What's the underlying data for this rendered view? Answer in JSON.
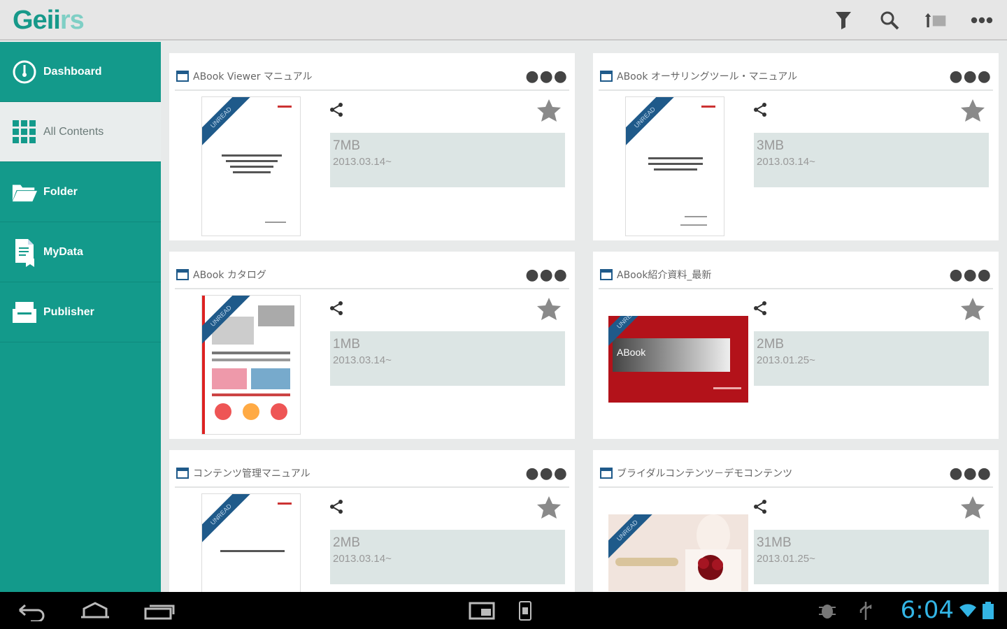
{
  "app": {
    "logo_main": "Geii",
    "logo_dim": "rs"
  },
  "toolbar": {
    "icons": [
      "filter-icon",
      "search-icon",
      "sort-icon",
      "overflow-menu-icon"
    ]
  },
  "sidebar": {
    "items": [
      {
        "label": "Dashboard",
        "icon": "dashboard-icon",
        "active": false
      },
      {
        "label": "All Contents",
        "icon": "grid-icon",
        "active": true
      },
      {
        "label": "Folder",
        "icon": "folder-icon",
        "active": false
      },
      {
        "label": "MyData",
        "icon": "mydata-icon",
        "active": false
      },
      {
        "label": "Publisher",
        "icon": "publisher-icon",
        "active": false
      }
    ]
  },
  "cards": [
    {
      "title": "ABook Viewer マニュアル",
      "size": "7MB",
      "date": "2013.03.14~",
      "ribbon": "UNREAD",
      "more": "●●●"
    },
    {
      "title": "ABook オーサリングツール・マニュアル",
      "size": "3MB",
      "date": "2013.03.14~",
      "ribbon": "UNREAD",
      "more": "●●●"
    },
    {
      "title": "ABook カタログ",
      "size": "1MB",
      "date": "2013.03.14~",
      "ribbon": "UNREAD",
      "more": "●●●"
    },
    {
      "title": "ABook紹介資料_最新",
      "size": "2MB",
      "date": "2013.01.25~",
      "ribbon": "UNREAD",
      "more": "●●●",
      "thumb_text": "ABook"
    },
    {
      "title": "コンテンツ管理マニュアル",
      "size": "2MB",
      "date": "2013.03.14~",
      "ribbon": "UNREAD",
      "more": "●●●"
    },
    {
      "title": "ブライダルコンテンツ－デモコンテンツ",
      "size": "31MB",
      "date": "2013.01.25~",
      "ribbon": "UNREAD",
      "more": "●●●"
    }
  ],
  "system": {
    "clock": "6:04"
  },
  "colors": {
    "accent": "#139a8b",
    "info_bg": "#dce5e4",
    "clock": "#33b5e5"
  }
}
